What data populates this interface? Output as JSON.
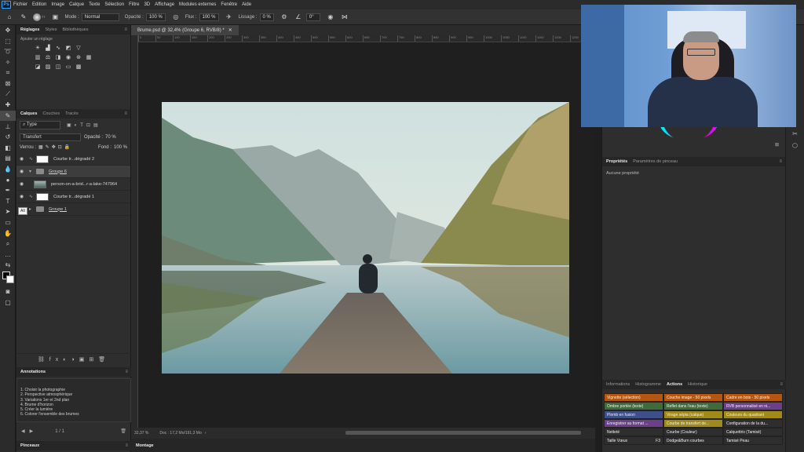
{
  "menubar": {
    "logo": "Ps",
    "items": [
      "Fichier",
      "Edition",
      "Image",
      "Calque",
      "Texte",
      "Sélection",
      "Filtre",
      "3D",
      "Affichage",
      "Modules externes",
      "Fenêtre",
      "Aide"
    ]
  },
  "options": {
    "brush_size": "77",
    "mode_label": "Mode :",
    "mode_value": "Normal",
    "opacity_label": "Opacité :",
    "opacity_value": "100 %",
    "flux_label": "Flux :",
    "flux_value": "100 %",
    "smoothing_label": "Lissage :",
    "smoothing_value": "0 %",
    "angle_value": "0°"
  },
  "left_panel": {
    "adjust_tabs": [
      "Réglages",
      "Styles",
      "Bibliothèques"
    ],
    "adjust_hint": "Ajouter un réglage",
    "layer_tabs": [
      "Calques",
      "Couches",
      "Tracés"
    ],
    "filter_type": "Type",
    "blend_mode": "Transfert",
    "opacity_label": "Opacité :",
    "opacity_value": "70 %",
    "lock_label": "Verrou :",
    "fill_label": "Fond :",
    "fill_value": "100 %",
    "layers": [
      {
        "name": "Courbe tr...dégradé 2"
      },
      {
        "name": "Groupe 6"
      },
      {
        "name": "person-on-a-brid...r-a-lake-747964"
      },
      {
        "name": "Courbe tr...dégradé 1"
      },
      {
        "name": "Groupe 1"
      }
    ],
    "tooltip": "Alt",
    "annotations_tab": "Annotations",
    "annotations": [
      "1. Choisir la photographie",
      "2. Perspective atmosphérique",
      "3. Variations 1er et 2nd plan",
      "4. Brume d'horizon",
      "5. Créer la lumière",
      "6. Colorer l'ensemble des brumes"
    ],
    "annotation_page": "1 / 1",
    "bottom_tab": "Pinceaux"
  },
  "document": {
    "tab_title": "Brume.psd @ 32,4% (Groupe 6, RVB/8) *",
    "ruler_ticks": [
      "0",
      "50",
      "100",
      "150",
      "200",
      "250",
      "300",
      "350",
      "400",
      "450",
      "500",
      "550",
      "600",
      "650",
      "700",
      "750",
      "800",
      "850",
      "900",
      "950",
      "1000",
      "1050",
      "1100",
      "1150",
      "1200",
      "1250"
    ],
    "zoom": "32,37 %",
    "doc_info": "Doc : 17,2 Mo/191,3 Mo",
    "montage_tab": "Montage"
  },
  "right_panel": {
    "properties_tabs": [
      "Propriétés",
      "Paramètres de pinceau"
    ],
    "properties_empty": "Aucune propriété",
    "actions_tabs": [
      "Informations",
      "Histogramme",
      "Actions",
      "Historique"
    ],
    "actions": [
      {
        "label": "Vignette (sélection)",
        "color": "#b4560f"
      },
      {
        "label": "Couche image - 50 pixels",
        "color": "#b4560f"
      },
      {
        "label": "Cadre en bois - 50 pixels",
        "color": "#b4560f"
      },
      {
        "label": "Ombre portée (texte)",
        "color": "#3f6b3b"
      },
      {
        "label": "Reflet dans l'eau (texte)",
        "color": "#3f6b3b"
      },
      {
        "label": "RVB personnalisé en ni...",
        "color": "#6b3f8a"
      },
      {
        "label": "Plomb en fusion",
        "color": "#3f4f8a"
      },
      {
        "label": "Virage sépia (calque)",
        "color": "#a08a1a"
      },
      {
        "label": "Couleurs du quadrant",
        "color": "#a08a1a"
      },
      {
        "label": "Enregistrer au format ...",
        "color": "#6b3f8a"
      },
      {
        "label": "Courbe de transfert de...",
        "color": "#a08a1a"
      },
      {
        "label": "Configuration de la du...",
        "color": "#2e2e2e"
      },
      {
        "label": "Netteté",
        "color": "#2e2e2e"
      },
      {
        "label": "Courbe (Couleur)",
        "color": "#2e2e2e"
      },
      {
        "label": "Calquettrix (Tamisé)",
        "color": "#2e2e2e"
      },
      {
        "label": "Taille Vœux",
        "color": "#2e2e2e"
      },
      {
        "label": "Dodge&Burn courbes",
        "color": "#2e2e2e"
      },
      {
        "label": "Tamisé Peau",
        "color": "#2e2e2e"
      }
    ],
    "action_shortcut": "F3"
  }
}
